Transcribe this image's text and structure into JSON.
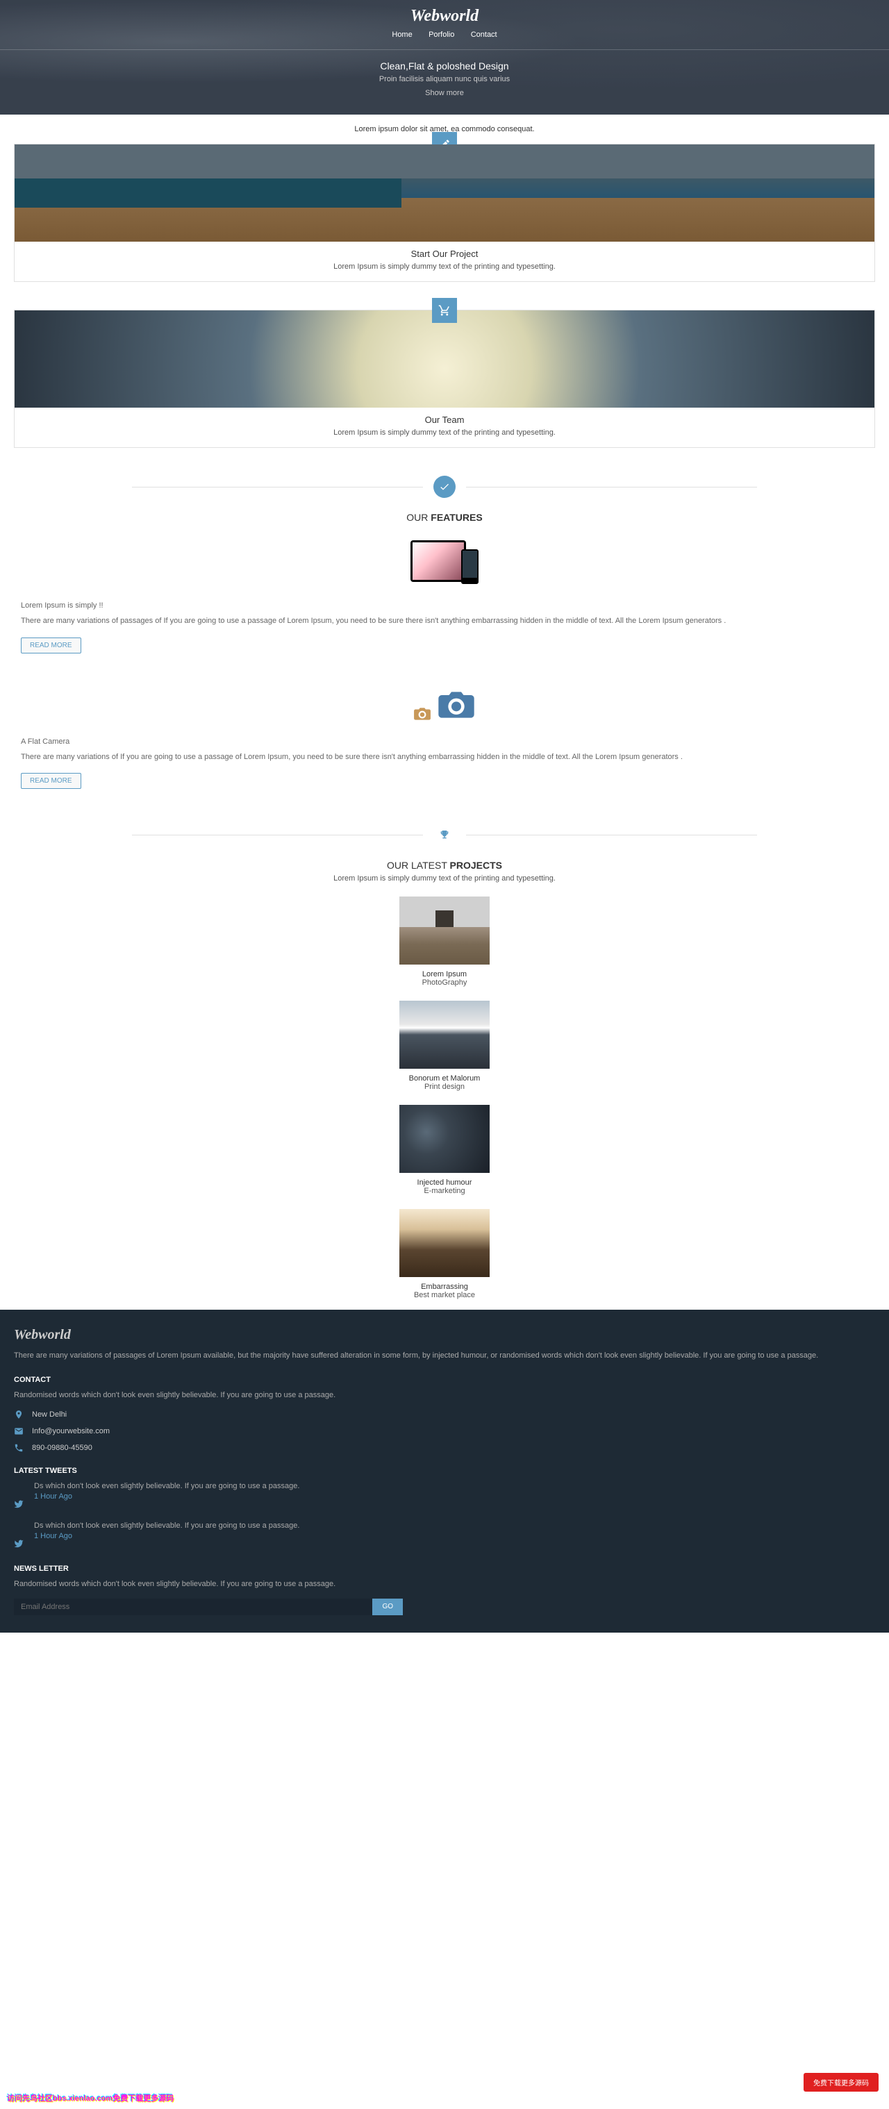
{
  "header": {
    "logo": "Webworld",
    "nav": {
      "home": "Home",
      "portfolio": "Porfolio",
      "contact": "Contact"
    },
    "hero": {
      "title": "Clean,Flat & poloshed Design",
      "subtitle": "Proin facilisis aliquam nunc quis varius",
      "more": "Show more"
    }
  },
  "intro": "Lorem ipsum dolor sit amet, ea commodo consequat.",
  "cards": [
    {
      "title": "Start Our Project",
      "desc": "Lorem Ipsum is simply dummy text of the printing and typesetting."
    },
    {
      "title": "Our Team",
      "desc": "Lorem Ipsum is simply dummy text of the printing and typesetting."
    }
  ],
  "features": {
    "heading_light": "OUR ",
    "heading_bold": "FEATURES",
    "items": [
      {
        "title": "Lorem Ipsum is simply !!",
        "desc": "There are many variations of passages of If you are going to use a passage of Lorem Ipsum, you need to be sure there isn't anything embarrassing hidden in the middle of text. All the Lorem Ipsum generators .",
        "btn": "READ MORE"
      },
      {
        "title": "A Flat Camera",
        "desc": "There are many variations of If you are going to use a passage of Lorem Ipsum, you need to be sure there isn't anything embarrassing hidden in the middle of text. All the Lorem Ipsum generators .",
        "btn": "READ MORE"
      }
    ]
  },
  "projects": {
    "heading_light": "OUR LATEST ",
    "heading_bold": "PROJECTS",
    "subtitle": "Lorem Ipsum is simply dummy text of the printing and typesetting.",
    "items": [
      {
        "title": "Lorem Ipsum",
        "cat": "PhotoGraphy"
      },
      {
        "title": "Bonorum et Malorum",
        "cat": "Print design"
      },
      {
        "title": "Injected humour",
        "cat": "E-marketing"
      },
      {
        "title": "Embarrassing",
        "cat": "Best market place"
      }
    ]
  },
  "footer": {
    "logo": "Webworld",
    "desc": "There are many variations of passages of Lorem Ipsum available, but the majority have suffered alteration in some form, by injected humour, or randomised words which don't look even slightly believable. If you are going to use a passage.",
    "contact": {
      "heading": "CONTACT",
      "desc": "Randomised words which don't look even slightly believable. If you are going to use a passage.",
      "address": "New Delhi",
      "email": "Info@yourwebsite.com",
      "phone": "890-09880-45590"
    },
    "tweets": {
      "heading": "LATEST TWEETS",
      "items": [
        {
          "text": "Ds which don't look even slightly believable. If you are going to use a passage.",
          "time": "1 Hour Ago"
        },
        {
          "text": "Ds which don't look even slightly believable. If you are going to use a passage.",
          "time": "1 Hour Ago"
        }
      ]
    },
    "newsletter": {
      "heading": "NEWS LETTER",
      "desc": "Randomised words which don't look even slightly believable. If you are going to use a passage.",
      "placeholder": "Email Address",
      "btn": "GO"
    }
  },
  "red_button": "免费下载更多源码",
  "watermark": "访问先鸟社区bbs.xienlao.com免费下载更多源码"
}
